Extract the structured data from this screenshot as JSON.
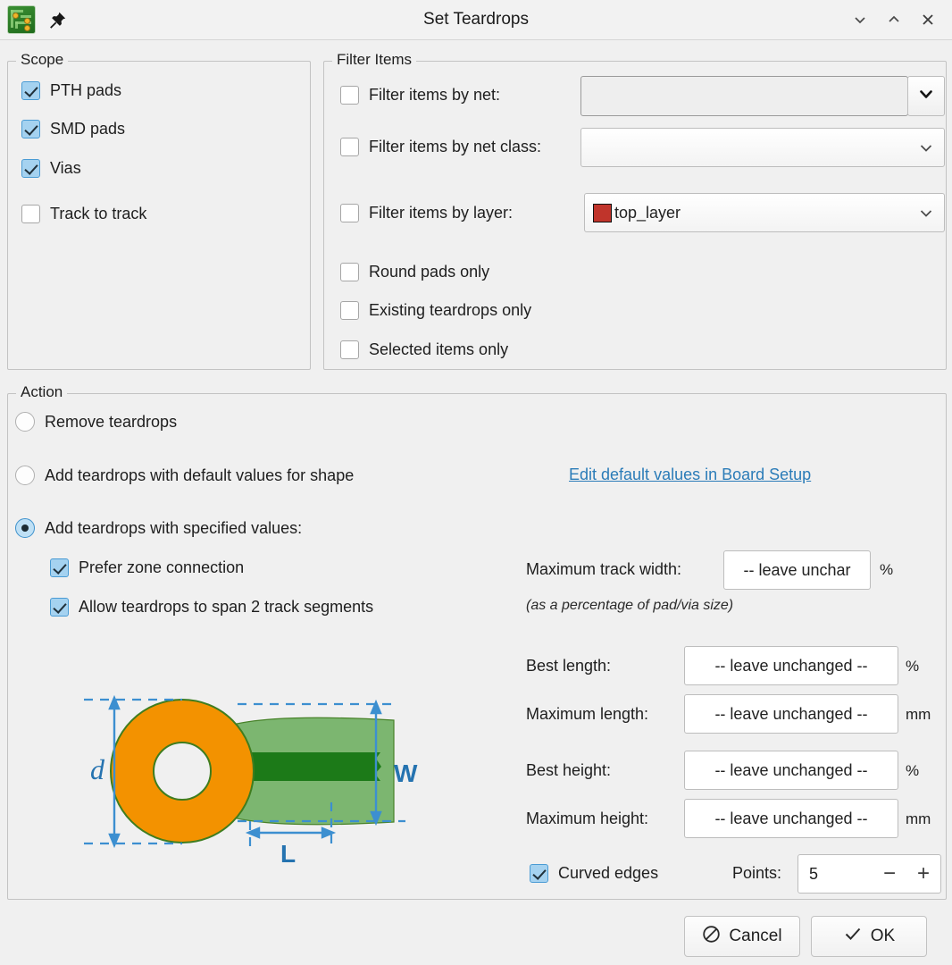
{
  "window": {
    "title": "Set Teardrops",
    "app_icon": "pcb-board-icon",
    "pin_icon": "pushpin-icon",
    "controls": [
      {
        "name": "minimize-button",
        "glyph": "chevron-down-icon"
      },
      {
        "name": "maximize-button",
        "glyph": "chevron-up-icon"
      },
      {
        "name": "close-button",
        "glyph": "close-icon"
      }
    ]
  },
  "scope": {
    "legend": "Scope",
    "items": [
      {
        "label": "PTH pads",
        "checked": true
      },
      {
        "label": "SMD pads",
        "checked": true
      },
      {
        "label": "Vias",
        "checked": true
      },
      {
        "label": "Track to track",
        "checked": false
      }
    ]
  },
  "filter": {
    "legend": "Filter Items",
    "by_net": {
      "label": "Filter items by net:",
      "checked": false,
      "value": "",
      "dropdown_icon": "chevron-down-icon"
    },
    "by_net_class": {
      "label": "Filter items by net class:",
      "checked": false,
      "value": "",
      "dropdown_icon": "chevron-down-icon"
    },
    "by_layer": {
      "label": "Filter items by layer:",
      "checked": false,
      "value": "top_layer",
      "swatch_color": "#c0342b",
      "dropdown_icon": "chevron-down-icon"
    },
    "options": [
      {
        "label": "Round pads only",
        "checked": false
      },
      {
        "label": "Existing teardrops only",
        "checked": false
      },
      {
        "label": "Selected items only",
        "checked": false
      }
    ]
  },
  "action": {
    "legend": "Action",
    "radios": [
      {
        "label": "Remove teardrops",
        "selected": false
      },
      {
        "label": "Add teardrops with default values for shape",
        "selected": false
      },
      {
        "label": "Add teardrops with specified values:",
        "selected": true
      }
    ],
    "link": "Edit default values in Board Setup",
    "sub_checkboxes": [
      {
        "label": "Prefer zone connection",
        "checked": true
      },
      {
        "label": "Allow teardrops to span 2 track segments",
        "checked": true
      }
    ],
    "max_track_width": {
      "label": "Maximum track width:",
      "value": "-- leave unchar",
      "unit": "%"
    },
    "percentage_hint": "(as a percentage of pad/via size)",
    "params": [
      {
        "label": "Best length:",
        "value": "-- leave unchanged --",
        "unit": "%"
      },
      {
        "label": "Maximum length:",
        "value": "-- leave unchanged --",
        "unit": "mm"
      },
      {
        "label": "Best height:",
        "value": "-- leave unchanged --",
        "unit": "%"
      },
      {
        "label": "Maximum height:",
        "value": "-- leave unchanged --",
        "unit": "mm"
      }
    ],
    "curved_edges": {
      "label": "Curved edges",
      "checked": true
    },
    "points": {
      "label": "Points:",
      "value": "5",
      "minus": "−",
      "plus": "+"
    }
  },
  "diagram": {
    "name": "teardrop-illustration",
    "labels": {
      "d": "d",
      "W": "W",
      "L": "L"
    },
    "colors": {
      "pad": "#F39200",
      "pad_outline": "#3F7D1F",
      "track": "#1C7A18",
      "teardrop": "#76B36A",
      "dimension": "#3C8FD0",
      "hole": "#F0F0F0"
    }
  },
  "buttons": {
    "cancel": {
      "label": "Cancel",
      "icon": "no-entry-icon"
    },
    "ok": {
      "label": "OK",
      "icon": "check-icon"
    }
  }
}
